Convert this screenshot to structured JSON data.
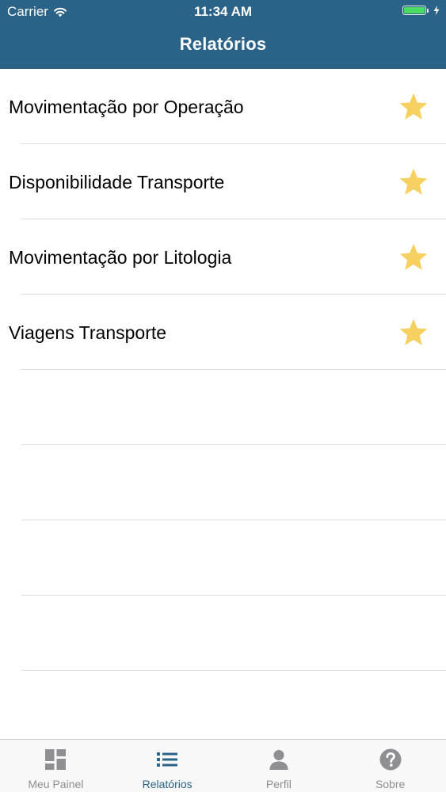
{
  "status_bar": {
    "carrier": "Carrier",
    "time": "11:34 AM",
    "battery_level": 1.0
  },
  "nav": {
    "title": "Relatórios"
  },
  "reports": [
    {
      "label": "Movimentação por Operação",
      "favorite": true
    },
    {
      "label": "Disponibilidade Transporte",
      "favorite": true
    },
    {
      "label": "Movimentação por Litologia",
      "favorite": true
    },
    {
      "label": "Viagens Transporte",
      "favorite": true
    }
  ],
  "tabs": [
    {
      "label": "Meu Painel",
      "icon": "dashboard-icon",
      "active": false
    },
    {
      "label": "Relatórios",
      "icon": "list-icon",
      "active": true
    },
    {
      "label": "Perfil",
      "icon": "person-icon",
      "active": false
    },
    {
      "label": "Sobre",
      "icon": "question-icon",
      "active": false
    }
  ],
  "colors": {
    "header": "#2a6387",
    "accent": "#2a6387",
    "star": "#f6d162",
    "inactive_tab": "#8e8e93",
    "battery": "#4cd964"
  }
}
